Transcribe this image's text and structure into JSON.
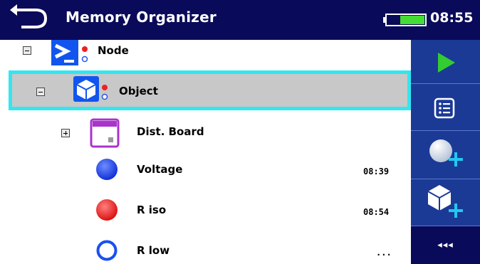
{
  "header": {
    "title": "Memory Organizer",
    "clock": "08:55",
    "icons": {
      "back": "back-arrow-icon",
      "battery": "battery-icon"
    }
  },
  "tree": {
    "node": {
      "label": "Node",
      "icon": "node-icon",
      "expanded": true
    },
    "object": {
      "label": "Object",
      "icon": "object-cube-icon",
      "expanded": true,
      "selected": true
    },
    "dist_board": {
      "label": "Dist. Board",
      "icon": "distribution-board-icon",
      "expanded": false
    },
    "measurements": [
      {
        "label": "Voltage",
        "time": "08:39",
        "icon": "blue-filled-circle-icon"
      },
      {
        "label": "R iso",
        "time": "08:54",
        "icon": "red-filled-circle-icon"
      },
      {
        "label": "R low",
        "time": "...",
        "icon": "blue-ring-icon"
      }
    ]
  },
  "sidebar": {
    "buttons": [
      {
        "icon": "play-icon"
      },
      {
        "icon": "list-icon"
      },
      {
        "icon": "add-measurement-icon"
      },
      {
        "icon": "add-object-icon"
      }
    ],
    "more_label": "◂◂◂"
  },
  "colors": {
    "header_bg": "#0a0a5a",
    "sidebar_bg": "#1b3a96",
    "selection_border": "#33e6f0",
    "selection_bg": "#c8c8c8",
    "play_green": "#33cc33",
    "plus_cyan": "#22c8f0"
  }
}
